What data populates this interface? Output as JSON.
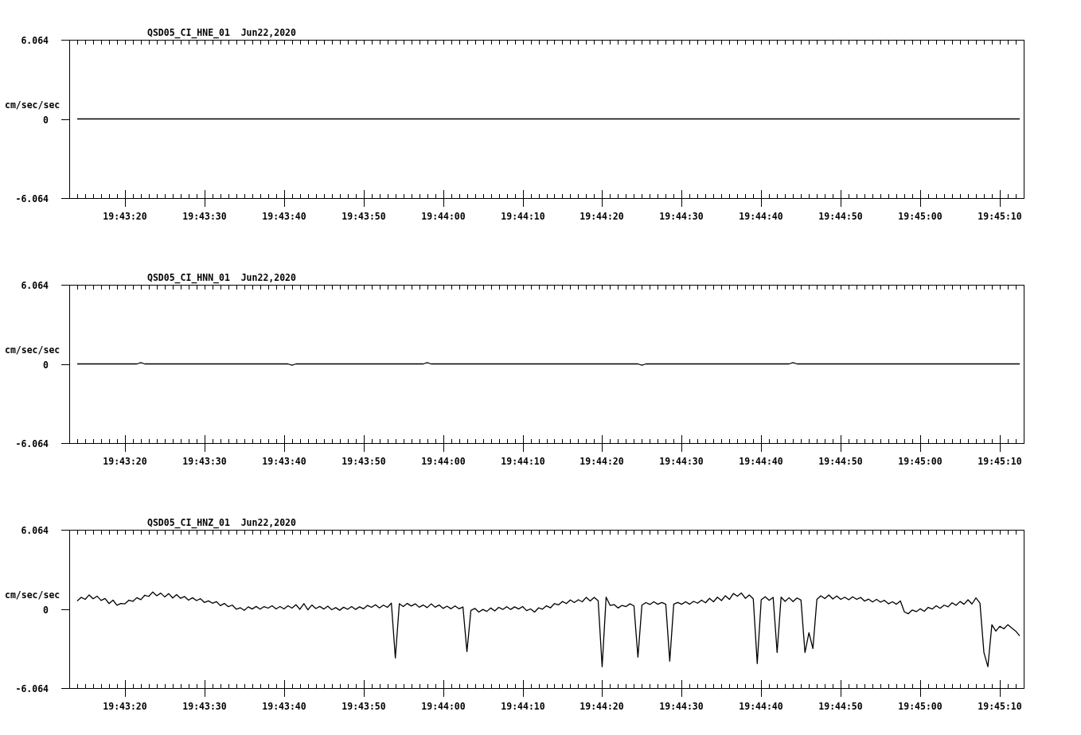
{
  "panels": [
    {
      "chart_data": {
        "type": "line",
        "title": "QSD05_CI_HNE_01  Jun22,2020",
        "ylabel": "cm/sec/sec",
        "ylim": [
          -6.064,
          6.064
        ],
        "yticks": [
          6.064,
          0,
          -6.064
        ],
        "categories": [
          null,
          null,
          null,
          null,
          null,
          null,
          null,
          null,
          null,
          null,
          null,
          null,
          "19:43:20",
          null,
          null,
          null,
          null,
          null,
          null,
          null,
          null,
          null,
          null,
          null,
          null,
          null,
          null,
          null,
          null,
          null,
          null,
          null,
          "19:43:30",
          null,
          null,
          null,
          null,
          null,
          null,
          null,
          null,
          null,
          null,
          null,
          null,
          null,
          null,
          null,
          null,
          null,
          null,
          null,
          "19:43:40",
          null,
          null,
          null,
          null,
          null,
          null,
          null,
          null,
          null,
          null,
          null,
          null,
          null,
          null,
          null,
          null,
          null,
          null,
          null,
          "19:43:50",
          null,
          null,
          null,
          null,
          null,
          null,
          null,
          null,
          null,
          null,
          null,
          null,
          null,
          null,
          null,
          null,
          null,
          null,
          null,
          "19:44:00",
          null,
          null,
          null,
          null,
          null,
          null,
          null,
          null,
          null,
          null,
          null,
          null,
          null,
          null,
          null,
          null,
          null,
          null,
          null,
          "19:44:10",
          null,
          null,
          null,
          null,
          null,
          null,
          null,
          null,
          null,
          null,
          null,
          null,
          null,
          null,
          null,
          null,
          null,
          null,
          null,
          "19:44:20",
          null,
          null,
          null,
          null,
          null,
          null,
          null,
          null,
          null,
          null,
          null,
          null,
          null,
          null,
          null,
          null,
          null,
          null,
          null,
          "19:44:30",
          null,
          null,
          null,
          null,
          null,
          null,
          null,
          null,
          null,
          null,
          null,
          null,
          null,
          null,
          null,
          null,
          null,
          null,
          null,
          "19:44:40",
          null,
          null,
          null,
          null,
          null,
          null,
          null,
          null,
          null,
          null,
          null,
          null,
          null,
          null,
          null,
          null,
          null,
          null,
          null,
          "19:44:50",
          null,
          null,
          null,
          null,
          null,
          null,
          null,
          null,
          null,
          null,
          null,
          null,
          null,
          null,
          null,
          null,
          null,
          null,
          null,
          "19:45:00",
          null,
          null,
          null,
          null,
          null,
          null,
          null,
          null,
          null,
          null,
          null,
          null,
          null,
          null,
          null,
          null,
          null,
          null,
          null,
          "19:45:10",
          null,
          null,
          null,
          null,
          null
        ],
        "series": [
          {
            "color": "#000000",
            "values": [
              0,
              0,
              0,
              0,
              0,
              0,
              0,
              0,
              0,
              0,
              0,
              0,
              0,
              0,
              0,
              0,
              0,
              0,
              0,
              0,
              0,
              0,
              0,
              0,
              0,
              0,
              0,
              0,
              0,
              0,
              0,
              0,
              0,
              0,
              0,
              0,
              0,
              0,
              0,
              0,
              0,
              0,
              0,
              0,
              0,
              0,
              0,
              0,
              0,
              0,
              0,
              0,
              0,
              0,
              0,
              0,
              0,
              0,
              0,
              0,
              0,
              0,
              0,
              0,
              0,
              0,
              0,
              0,
              0,
              0,
              0,
              0,
              0,
              0,
              0,
              0,
              0,
              0,
              0,
              0,
              0,
              0,
              0,
              0,
              0,
              0,
              0,
              0,
              0,
              0,
              0,
              0,
              0,
              0,
              0,
              0,
              0,
              0,
              0,
              0,
              0,
              0,
              0,
              0,
              0,
              0,
              0,
              0,
              0,
              0,
              0,
              0,
              0,
              0,
              0,
              0,
              0,
              0,
              0,
              0,
              0,
              0,
              0,
              0,
              0,
              0,
              0,
              0,
              0,
              0,
              0,
              0,
              0,
              0,
              0,
              0,
              0,
              0,
              0,
              0,
              0,
              0,
              0,
              0,
              0,
              0,
              0,
              0,
              0,
              0,
              0,
              0,
              0,
              0,
              0,
              0,
              0,
              0,
              0,
              0,
              0,
              0,
              0,
              0,
              0,
              0,
              0,
              0,
              0,
              0,
              0,
              0,
              0,
              0,
              0,
              0,
              0,
              0,
              0,
              0,
              0,
              0,
              0,
              0,
              0,
              0,
              0,
              0,
              0,
              0,
              0,
              0,
              0,
              0,
              0,
              0,
              0,
              0,
              0,
              0,
              0,
              0,
              0,
              0,
              0,
              0,
              0,
              0,
              0,
              0,
              0,
              0,
              0,
              0,
              0,
              0,
              0,
              0,
              0,
              0,
              0,
              0,
              0,
              0,
              0,
              0,
              0,
              0,
              0,
              0,
              0,
              0,
              0,
              0,
              0,
              0,
              0,
              0
            ]
          }
        ]
      }
    },
    {
      "chart_data": {
        "type": "line",
        "title": "QSD05_CI_HNN_01  Jun22,2020",
        "ylabel": "cm/sec/sec",
        "ylim": [
          -6.064,
          6.064
        ],
        "yticks": [
          6.064,
          0,
          -6.064
        ],
        "categories": [
          null,
          null,
          null,
          null,
          null,
          null,
          null,
          null,
          null,
          null,
          null,
          null,
          "19:43:20",
          null,
          null,
          null,
          null,
          null,
          null,
          null,
          null,
          null,
          null,
          null,
          null,
          null,
          null,
          null,
          null,
          null,
          null,
          null,
          "19:43:30",
          null,
          null,
          null,
          null,
          null,
          null,
          null,
          null,
          null,
          null,
          null,
          null,
          null,
          null,
          null,
          null,
          null,
          null,
          null,
          "19:43:40",
          null,
          null,
          null,
          null,
          null,
          null,
          null,
          null,
          null,
          null,
          null,
          null,
          null,
          null,
          null,
          null,
          null,
          null,
          null,
          "19:43:50",
          null,
          null,
          null,
          null,
          null,
          null,
          null,
          null,
          null,
          null,
          null,
          null,
          null,
          null,
          null,
          null,
          null,
          null,
          null,
          "19:44:00",
          null,
          null,
          null,
          null,
          null,
          null,
          null,
          null,
          null,
          null,
          null,
          null,
          null,
          null,
          null,
          null,
          null,
          null,
          null,
          "19:44:10",
          null,
          null,
          null,
          null,
          null,
          null,
          null,
          null,
          null,
          null,
          null,
          null,
          null,
          null,
          null,
          null,
          null,
          null,
          null,
          "19:44:20",
          null,
          null,
          null,
          null,
          null,
          null,
          null,
          null,
          null,
          null,
          null,
          null,
          null,
          null,
          null,
          null,
          null,
          null,
          null,
          "19:44:30",
          null,
          null,
          null,
          null,
          null,
          null,
          null,
          null,
          null,
          null,
          null,
          null,
          null,
          null,
          null,
          null,
          null,
          null,
          null,
          "19:44:40",
          null,
          null,
          null,
          null,
          null,
          null,
          null,
          null,
          null,
          null,
          null,
          null,
          null,
          null,
          null,
          null,
          null,
          null,
          null,
          "19:44:50",
          null,
          null,
          null,
          null,
          null,
          null,
          null,
          null,
          null,
          null,
          null,
          null,
          null,
          null,
          null,
          null,
          null,
          null,
          null,
          "19:45:00",
          null,
          null,
          null,
          null,
          null,
          null,
          null,
          null,
          null,
          null,
          null,
          null,
          null,
          null,
          null,
          null,
          null,
          null,
          null,
          "19:45:10",
          null,
          null,
          null,
          null,
          null
        ],
        "series": [
          {
            "color": "#000000",
            "values": [
              0,
              0,
              0,
              0,
              0,
              0,
              0,
              0,
              0,
              0,
              0,
              0,
              0,
              0,
              0,
              0,
              0.1,
              0,
              0,
              0,
              0,
              0,
              0,
              0,
              0,
              0,
              0,
              0,
              0,
              0,
              0,
              0,
              0,
              0,
              0,
              0,
              0,
              0,
              0,
              0,
              0,
              0,
              0,
              0,
              0,
              0,
              0,
              0,
              0,
              0,
              0,
              0,
              0,
              0,
              -0.1,
              0,
              0,
              0,
              0,
              0,
              0,
              0,
              0,
              0,
              0,
              0,
              0,
              0,
              0,
              0,
              0,
              0,
              0,
              0,
              0,
              0,
              0,
              0,
              0,
              0,
              0,
              0,
              0,
              0,
              0,
              0,
              0,
              0,
              0.1,
              0,
              0,
              0,
              0,
              0,
              0,
              0,
              0,
              0,
              0,
              0,
              0,
              0,
              0,
              0,
              0,
              0,
              0,
              0,
              0,
              0,
              0,
              0,
              0,
              0,
              0,
              0,
              0,
              0,
              0,
              0,
              0,
              0,
              0,
              0,
              0,
              0,
              0,
              0,
              0,
              0,
              0,
              0,
              0,
              0,
              0,
              0,
              0,
              0,
              0,
              0,
              0,
              0,
              -0.1,
              0,
              0,
              0,
              0,
              0,
              0,
              0,
              0,
              0,
              0,
              0,
              0,
              0,
              0,
              0,
              0,
              0,
              0,
              0,
              0,
              0,
              0,
              0,
              0,
              0,
              0,
              0,
              0,
              0,
              0,
              0,
              0,
              0,
              0,
              0,
              0,
              0,
              0.1,
              0,
              0,
              0,
              0,
              0,
              0,
              0,
              0,
              0,
              0,
              0,
              0,
              0,
              0,
              0,
              0,
              0,
              0,
              0,
              0,
              0,
              0,
              0,
              0,
              0,
              0,
              0,
              0,
              0,
              0,
              0,
              0,
              0,
              0,
              0,
              0,
              0,
              0,
              0,
              0,
              0,
              0,
              0,
              0,
              0,
              0,
              0,
              0,
              0,
              0,
              0,
              0,
              0,
              0,
              0,
              0,
              0
            ]
          }
        ]
      }
    },
    {
      "chart_data": {
        "type": "line",
        "title": "QSD05_CI_HNZ_01  Jun22,2020",
        "ylabel": "cm/sec/sec",
        "ylim": [
          -6.064,
          6.064
        ],
        "yticks": [
          6.064,
          0,
          -6.064
        ],
        "categories": [
          null,
          null,
          null,
          null,
          null,
          null,
          null,
          null,
          null,
          null,
          null,
          null,
          "19:43:20",
          null,
          null,
          null,
          null,
          null,
          null,
          null,
          null,
          null,
          null,
          null,
          null,
          null,
          null,
          null,
          null,
          null,
          null,
          null,
          "19:43:30",
          null,
          null,
          null,
          null,
          null,
          null,
          null,
          null,
          null,
          null,
          null,
          null,
          null,
          null,
          null,
          null,
          null,
          null,
          null,
          "19:43:40",
          null,
          null,
          null,
          null,
          null,
          null,
          null,
          null,
          null,
          null,
          null,
          null,
          null,
          null,
          null,
          null,
          null,
          null,
          null,
          "19:43:50",
          null,
          null,
          null,
          null,
          null,
          null,
          null,
          null,
          null,
          null,
          null,
          null,
          null,
          null,
          null,
          null,
          null,
          null,
          null,
          "19:44:00",
          null,
          null,
          null,
          null,
          null,
          null,
          null,
          null,
          null,
          null,
          null,
          null,
          null,
          null,
          null,
          null,
          null,
          null,
          null,
          "19:44:10",
          null,
          null,
          null,
          null,
          null,
          null,
          null,
          null,
          null,
          null,
          null,
          null,
          null,
          null,
          null,
          null,
          null,
          null,
          null,
          "19:44:20",
          null,
          null,
          null,
          null,
          null,
          null,
          null,
          null,
          null,
          null,
          null,
          null,
          null,
          null,
          null,
          null,
          null,
          null,
          null,
          "19:44:30",
          null,
          null,
          null,
          null,
          null,
          null,
          null,
          null,
          null,
          null,
          null,
          null,
          null,
          null,
          null,
          null,
          null,
          null,
          null,
          "19:44:40",
          null,
          null,
          null,
          null,
          null,
          null,
          null,
          null,
          null,
          null,
          null,
          null,
          null,
          null,
          null,
          null,
          null,
          null,
          null,
          "19:44:50",
          null,
          null,
          null,
          null,
          null,
          null,
          null,
          null,
          null,
          null,
          null,
          null,
          null,
          null,
          null,
          null,
          null,
          null,
          null,
          "19:45:00",
          null,
          null,
          null,
          null,
          null,
          null,
          null,
          null,
          null,
          null,
          null,
          null,
          null,
          null,
          null,
          null,
          null,
          null,
          null,
          "19:45:10",
          null,
          null,
          null,
          null,
          null
        ],
        "series": [
          {
            "color": "#000000",
            "values": [
              0.61,
              0.89,
              0.73,
              1.07,
              0.78,
              0.98,
              0.65,
              0.8,
              0.41,
              0.67,
              0.28,
              0.42,
              0.39,
              0.67,
              0.58,
              0.86,
              0.71,
              1.05,
              0.96,
              1.3,
              1.01,
              1.21,
              0.92,
              1.18,
              0.84,
              1.1,
              0.81,
              0.95,
              0.67,
              0.86,
              0.64,
              0.78,
              0.49,
              0.62,
              0.44,
              0.56,
              0.25,
              0.42,
              0.17,
              0.29,
              -0.02,
              0.09,
              -0.11,
              0.16,
              -0.01,
              0.19,
              -0.02,
              0.18,
              0.06,
              0.24,
              0,
              0.18,
              0,
              0.24,
              0.06,
              0.32,
              -0.03,
              0.41,
              -0.07,
              0.3,
              0.03,
              0.19,
              -0.01,
              0.21,
              -0.06,
              0.1,
              -0.1,
              0.13,
              -0.03,
              0.18,
              -0.04,
              0.16,
              0.01,
              0.27,
              0.12,
              0.32,
              0.08,
              0.29,
              0.12,
              0.44,
              -3.76,
              0.4,
              0.18,
              0.42,
              0.22,
              0.39,
              0.13,
              0.3,
              0.1,
              0.39,
              0.13,
              0.3,
              0.04,
              0.21,
              0.01,
              0.23,
              0.01,
              0.15,
              -3.27,
              -0.11,
              0.04,
              -0.24,
              -0.04,
              -0.19,
              0.07,
              -0.15,
              0.12,
              -0.04,
              0.17,
              -0.04,
              0.16,
              -0.01,
              0.18,
              -0.13,
              0,
              -0.24,
              0.08,
              -0.02,
              0.24,
              0.08,
              0.41,
              0.31,
              0.57,
              0.41,
              0.69,
              0.49,
              0.7,
              0.55,
              0.89,
              0.61,
              0.89,
              0.62,
              -4.43,
              0.9,
              0.27,
              0.33,
              0.07,
              0.27,
              0.18,
              0.39,
              0.23,
              -3.7,
              0.29,
              0.49,
              0.34,
              0.55,
              0.36,
              0.49,
              0.36,
              -4,
              0.36,
              0.49,
              0.36,
              0.55,
              0.36,
              0.58,
              0.44,
              0.67,
              0.47,
              0.81,
              0.55,
              0.9,
              0.64,
              1.01,
              0.73,
              1.18,
              0.97,
              1.22,
              0.81,
              1.07,
              0.78,
              -4.18,
              0.7,
              0.93,
              0.66,
              0.89,
              -3.34,
              0.9,
              0.58,
              0.86,
              0.56,
              0.84,
              0.68,
              -3.34,
              -1.82,
              -3.03,
              0.73,
              1.01,
              0.79,
              1.07,
              0.76,
              0.99,
              0.73,
              0.9,
              0.7,
              0.93,
              0.73,
              0.88,
              0.6,
              0.75,
              0.53,
              0.73,
              0.52,
              0.66,
              0.39,
              0.55,
              0.36,
              0.61,
              -0.23,
              -0.37,
              -0.08,
              -0.21,
              0.01,
              -0.18,
              0.12,
              -0.01,
              0.24,
              0.05,
              0.29,
              0.16,
              0.47,
              0.28,
              0.57,
              0.36,
              0.7,
              0.38,
              0.84,
              0.45,
              -3.34,
              -4.43,
              -1.21,
              -1.7,
              -1.33,
              -1.52,
              -1.21,
              -1.46,
              -1.7,
              -2.06
            ]
          }
        ]
      }
    }
  ]
}
